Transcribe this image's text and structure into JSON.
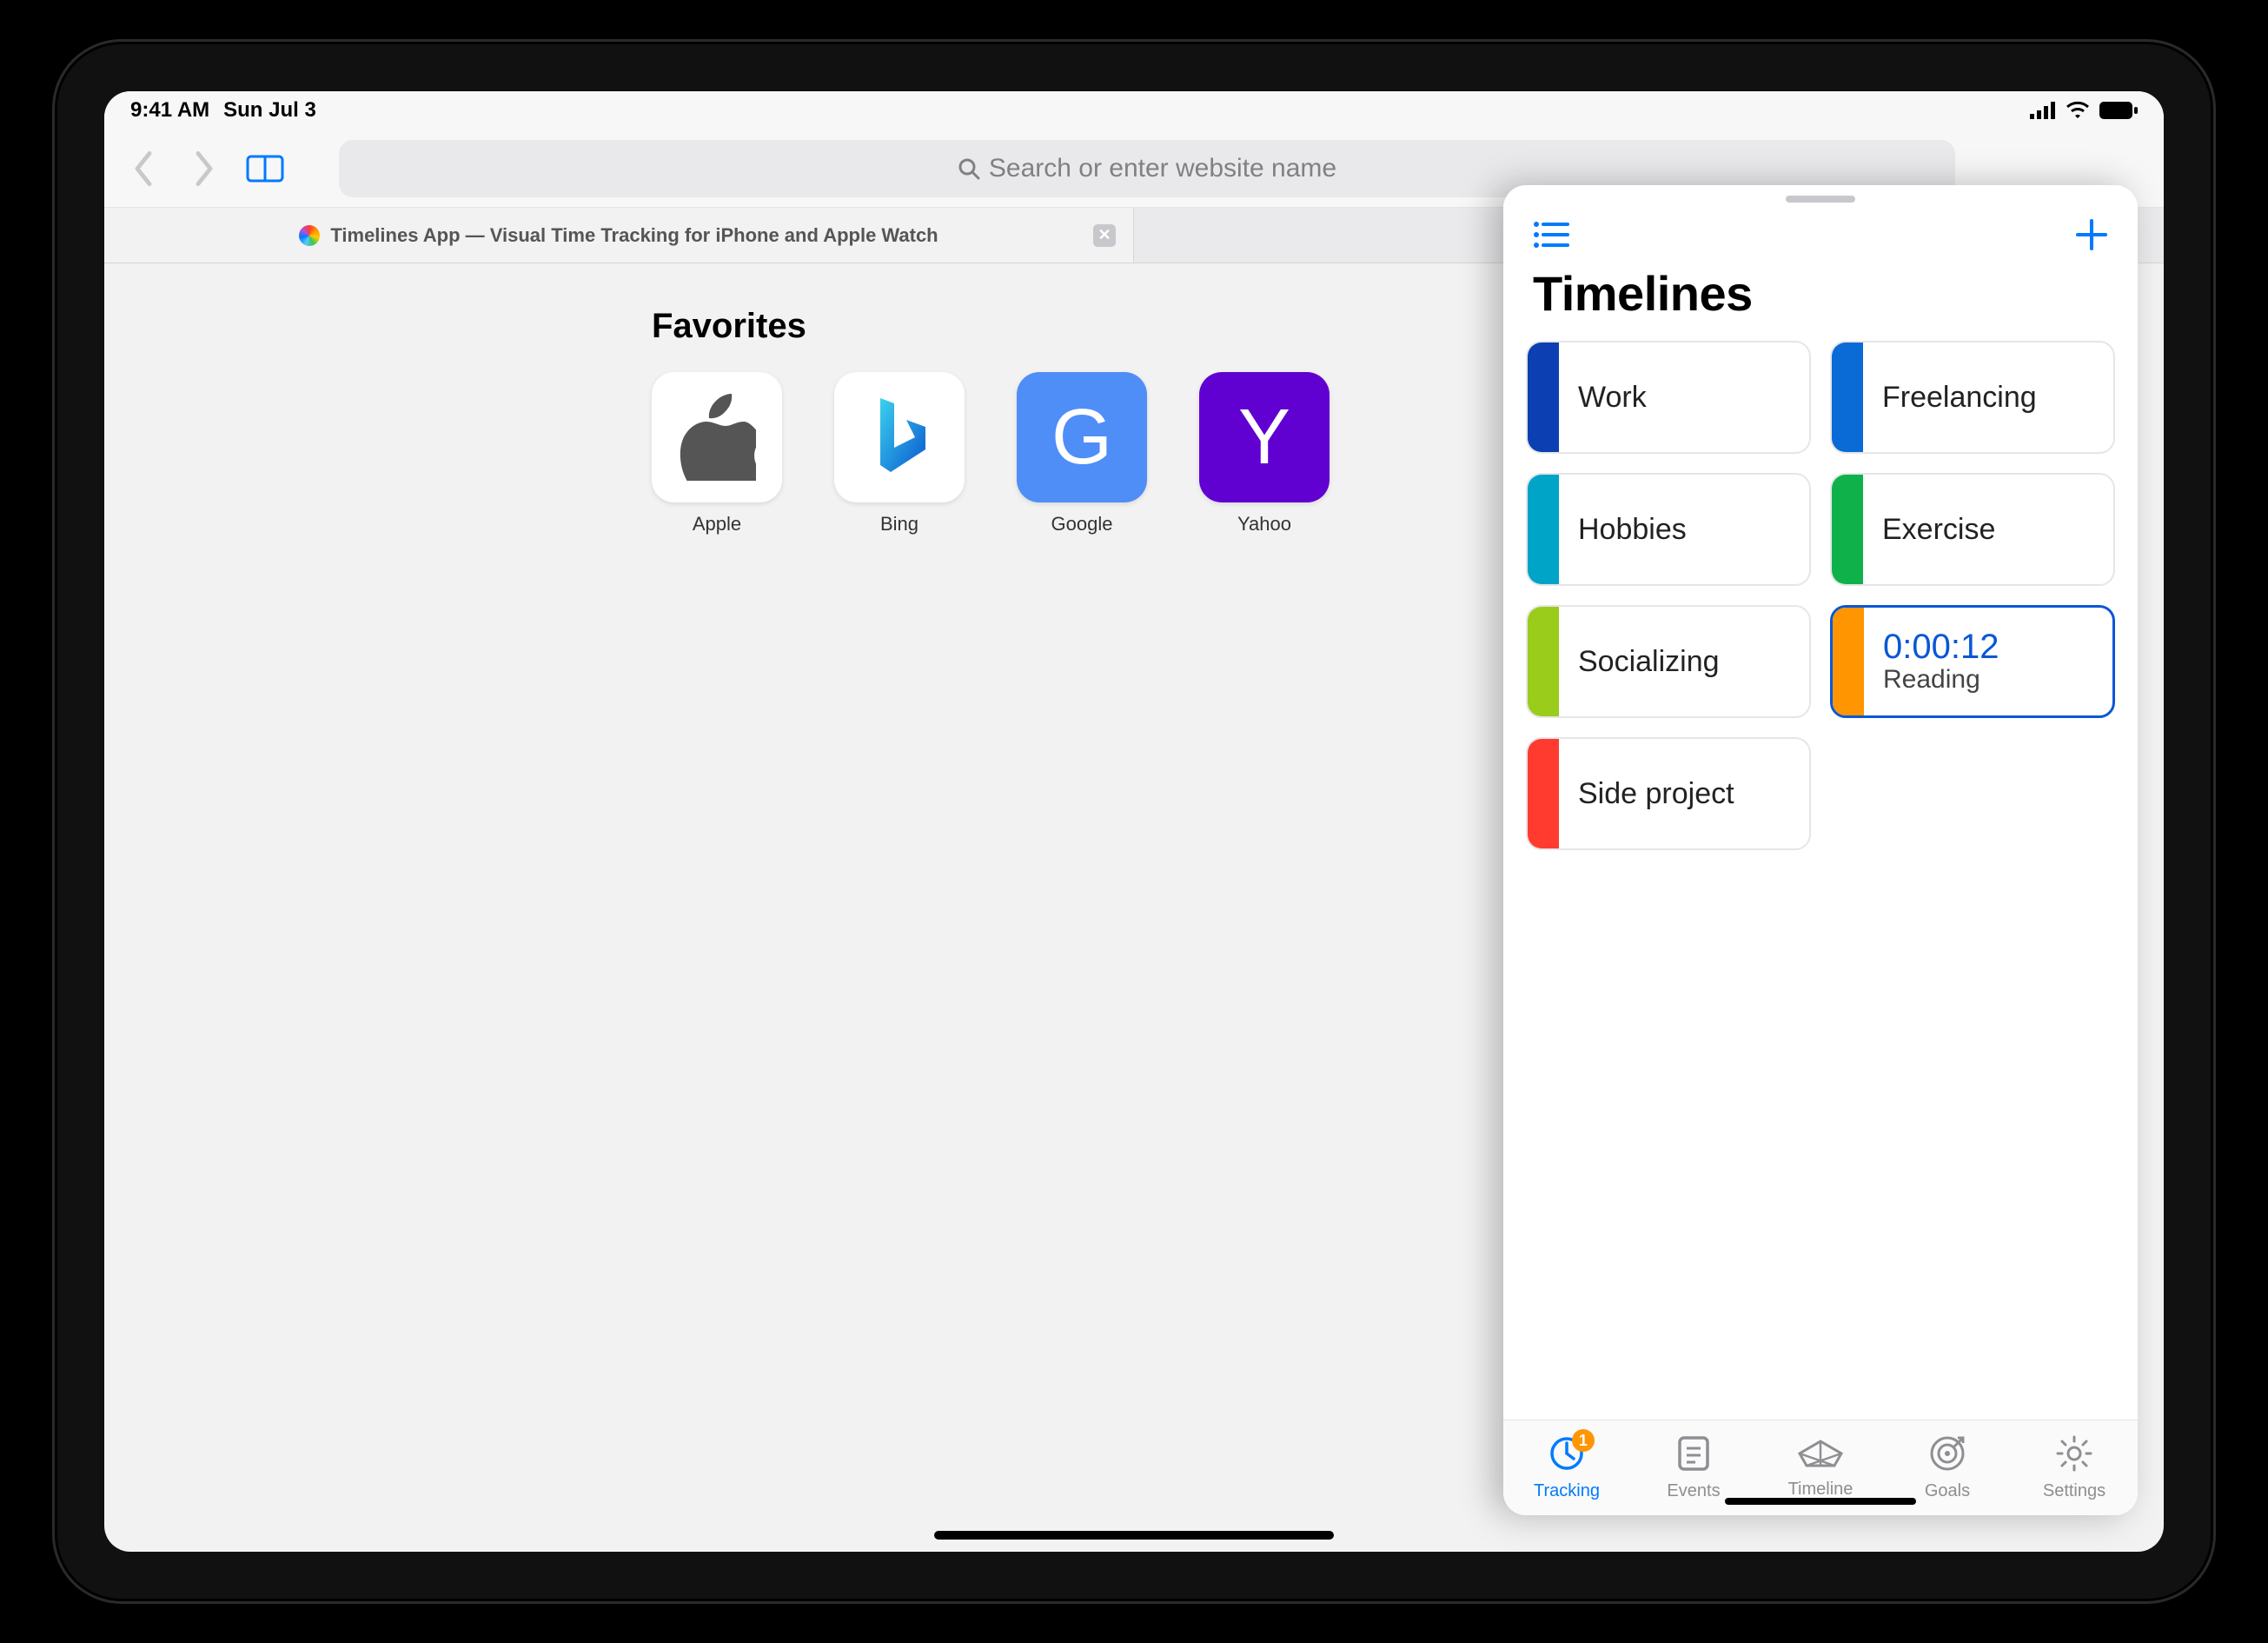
{
  "status": {
    "time": "9:41 AM",
    "date": "Sun Jul 3"
  },
  "safari": {
    "search_placeholder": "Search or enter website name",
    "tab_title": "Timelines App — Visual Time Tracking for iPhone and Apple Watch"
  },
  "favorites": {
    "heading": "Favorites",
    "items": [
      {
        "label": "Apple"
      },
      {
        "label": "Bing"
      },
      {
        "label": "Google",
        "letter": "G"
      },
      {
        "label": "Yahoo",
        "letter": "Y"
      }
    ]
  },
  "slideover": {
    "title": "Timelines",
    "cards": [
      {
        "label": "Work",
        "color": "#0c3fb2"
      },
      {
        "label": "Freelancing",
        "color": "#0a6bd6"
      },
      {
        "label": "Hobbies",
        "color": "#00a4c7"
      },
      {
        "label": "Exercise",
        "color": "#0fb24a"
      },
      {
        "label": "Socializing",
        "color": "#9acc1c"
      },
      {
        "label": "Reading",
        "color": "#ff9500",
        "active": true,
        "timer": "0:00:12"
      },
      {
        "label": "Side project",
        "color": "#ff3b30"
      }
    ],
    "tabbar": [
      {
        "label": "Tracking",
        "active": true,
        "badge": "1"
      },
      {
        "label": "Events"
      },
      {
        "label": "Timeline"
      },
      {
        "label": "Goals"
      },
      {
        "label": "Settings"
      }
    ]
  }
}
